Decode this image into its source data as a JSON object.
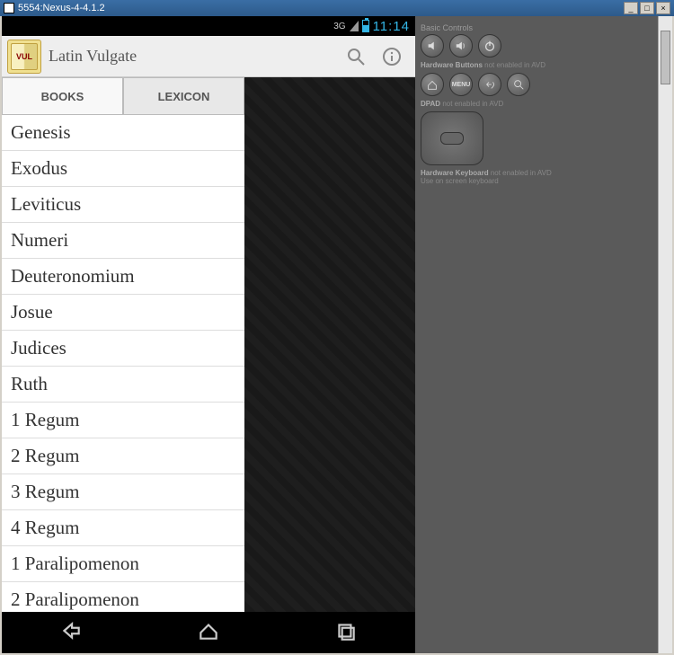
{
  "window": {
    "title": "5554:Nexus-4-4.1.2"
  },
  "status_bar": {
    "network": "3G",
    "clock": "11:14"
  },
  "action_bar": {
    "app_icon_text": "VUL",
    "title": "Latin Vulgate"
  },
  "tabs": {
    "books": "BOOKS",
    "lexicon": "LEXICON",
    "active": "books"
  },
  "books": [
    "Genesis",
    "Exodus",
    "Leviticus",
    "Numeri",
    "Deuteronomium",
    "Josue",
    "Judices",
    "Ruth",
    "1 Regum",
    "2 Regum",
    "3 Regum",
    "4 Regum",
    "1 Paralipomenon",
    "2 Paralipomenon"
  ],
  "emulator": {
    "basic_controls": "Basic Controls",
    "hw_buttons": "Hardware Buttons",
    "hw_buttons_note": "not enabled in AVD",
    "dpad": "DPAD",
    "dpad_note": "not enabled in AVD",
    "hw_keyboard": "Hardware Keyboard",
    "hw_keyboard_note": "not enabled in AVD",
    "hw_keyboard_sub": "Use on screen keyboard"
  }
}
